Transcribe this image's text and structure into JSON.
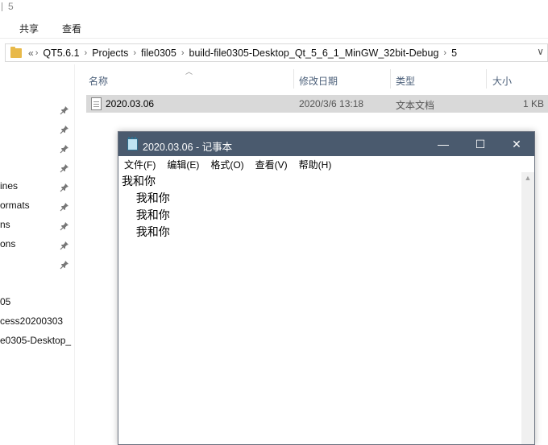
{
  "explorer": {
    "title_number": "5",
    "ribbon_tabs": [
      "共享",
      "查看"
    ],
    "address": {
      "overflow": "«",
      "crumbs": [
        "QT5.6.1",
        "Projects",
        "file0305",
        "build-file0305-Desktop_Qt_5_6_1_MinGW_32bit-Debug",
        "5"
      ]
    },
    "nav_items": [
      "",
      "",
      "",
      "",
      "ines",
      "ormats",
      "ns",
      "ons",
      "",
      "05",
      "cess20200303",
      "e0305-Desktop_"
    ],
    "columns": {
      "name": "名称",
      "modified": "修改日期",
      "type": "类型",
      "size": "大小"
    },
    "files": [
      {
        "name": "2020.03.06",
        "modified": "2020/3/6 13:18",
        "type": "文本文档",
        "size": "1 KB"
      }
    ]
  },
  "notepad": {
    "title": "2020.03.06 - 记事本",
    "menu": [
      "文件(F)",
      "编辑(E)",
      "格式(O)",
      "查看(V)",
      "帮助(H)"
    ],
    "content": "我和你\n    我和你\n    我和你\n    我和你",
    "controls": {
      "minimize": "—",
      "maximize": "☐",
      "close": "✕"
    }
  },
  "colors": {
    "titlebar": "#4a5a6e",
    "selected_row": "#d9d9d9",
    "header_text": "#4c607a",
    "folder": "#e8b94a"
  }
}
